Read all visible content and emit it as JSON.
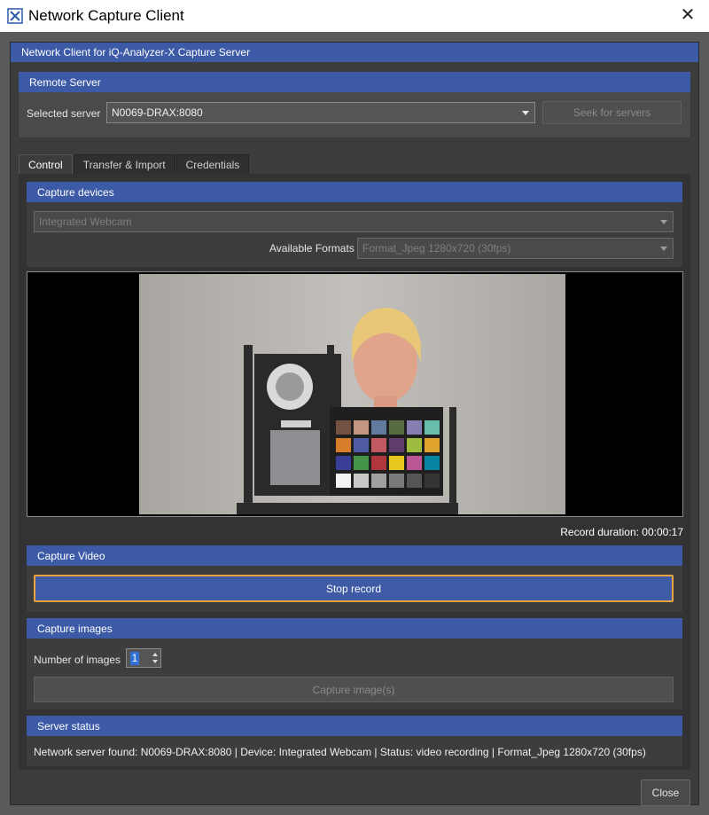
{
  "window": {
    "title": "Network Capture Client",
    "close_glyph": "✕"
  },
  "header": {
    "title": "Network Client for iQ-Analyzer-X Capture Server"
  },
  "remote_server": {
    "title": "Remote Server",
    "selected_label": "Selected server",
    "selected_value": "N0069-DRAX:8080",
    "seek_label": "Seek for servers"
  },
  "tabs": [
    {
      "label": "Control",
      "active": true
    },
    {
      "label": "Transfer & Import",
      "active": false
    },
    {
      "label": "Credentials",
      "active": false
    }
  ],
  "capture_devices": {
    "title": "Capture devices",
    "device_value": "Integrated Webcam",
    "formats_label": "Available Formats",
    "format_value": "Format_Jpeg 1280x720 (30fps)"
  },
  "preview": {
    "record_duration_label": "Record duration: 00:00:17"
  },
  "capture_video": {
    "title": "Capture Video",
    "stop_label": "Stop record"
  },
  "capture_images": {
    "title": "Capture images",
    "count_label": "Number of images",
    "count_value": "1",
    "capture_label": "Capture image(s)"
  },
  "server_status": {
    "title": "Server status",
    "text": "Network server found: N0069-DRAX:8080 | Device: Integrated Webcam | Status: video recording | Format_Jpeg 1280x720 (30fps)"
  },
  "footer": {
    "close_label": "Close"
  },
  "colors": {
    "accent_header": "#3c5aa6",
    "focus_border": "#e8a33d",
    "panel_bg": "#3c3c3c"
  }
}
